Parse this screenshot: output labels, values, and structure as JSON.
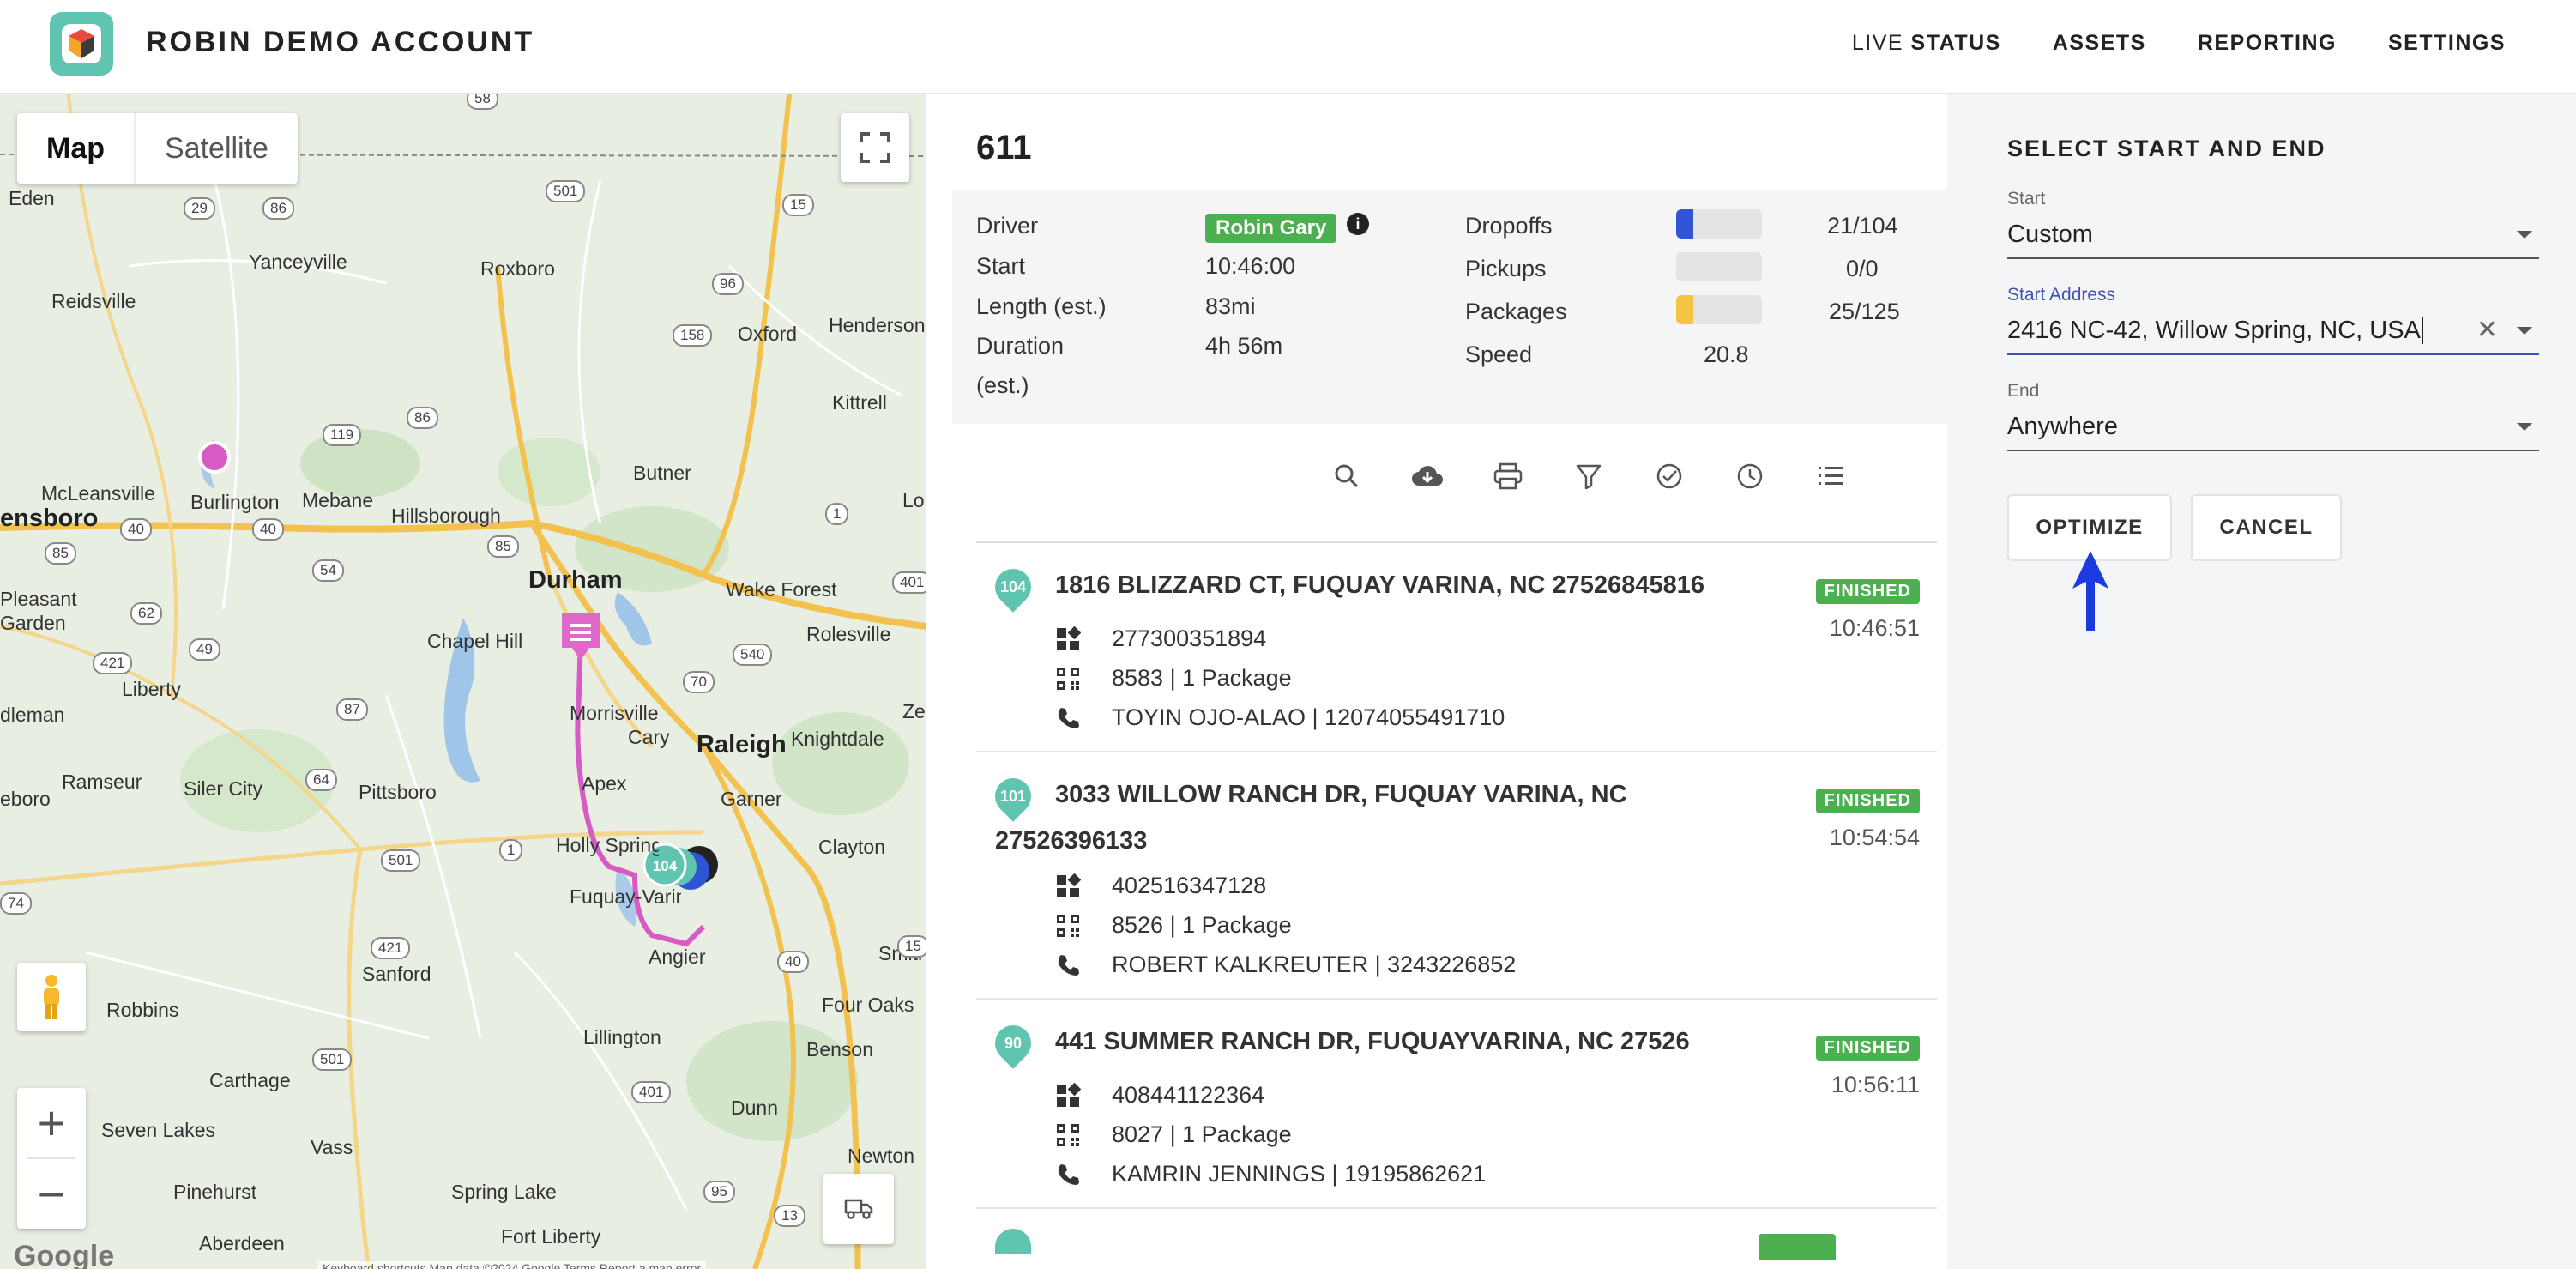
{
  "header": {
    "brand": "ROBIN DEMO ACCOUNT",
    "nav": [
      {
        "light": "LIVE ",
        "bold": "STATUS"
      },
      {
        "light": "",
        "bold": "ASSETS"
      },
      {
        "light": "",
        "bold": "REPORTING"
      },
      {
        "light": "",
        "bold": "SETTINGS"
      }
    ]
  },
  "map": {
    "toggle": {
      "map": "Map",
      "satellite": "Satellite"
    },
    "places": [
      "Eden",
      "Yanceyville",
      "Roxboro",
      "Oxford",
      "Henderson",
      "Reidsville",
      "Kittrell",
      "Butner",
      "McLeansville",
      "Burlington",
      "Mebane",
      "Hillsborough",
      "Durham",
      "Wake Forest",
      "Rolesville",
      "Chapel Hill",
      "Morrisville",
      "Cary",
      "Raleigh",
      "Knightdale",
      "Liberty",
      "Apex",
      "Garner",
      "Ramseur",
      "Siler City",
      "Pittsboro",
      "Holly Springs",
      "Clayton",
      "Fuquay-Varina",
      "Angier",
      "Four Oaks",
      "Sanford",
      "Robbins",
      "Lillington",
      "Benson",
      "Carthage",
      "Seven Lakes",
      "Vass",
      "Dunn",
      "Newton",
      "Pinehurst",
      "Spring Lake",
      "Fort Liberty",
      "Aberdeen",
      "Smith",
      "ensboro",
      "Pleasant Garden",
      "dleman",
      "eboro",
      "Lo",
      "Ze"
    ],
    "shields": [
      "58",
      "29",
      "86",
      "501",
      "15",
      "96",
      "158",
      "119",
      "86",
      "85",
      "54",
      "40",
      "40",
      "62",
      "49",
      "421",
      "87",
      "64",
      "70",
      "540",
      "1",
      "401",
      "501",
      "421",
      "40",
      "1",
      "15",
      "501",
      "401",
      "95",
      "13",
      "74",
      "85"
    ],
    "cluster_label": "104",
    "google": "Google",
    "footer": "Keyboard shortcuts   Map data ©2024 Google   Terms   Report a map error"
  },
  "route": {
    "title": "611",
    "driver_label": "Driver",
    "driver": "Robin Gary",
    "start_label": "Start",
    "start": "10:46:00",
    "length_label": "Length (est.)",
    "length": "83mi",
    "duration_label": "Duration",
    "duration_label2": "(est.)",
    "duration": "4h 56m",
    "dropoffs_label": "Dropoffs",
    "dropoffs": "21/104",
    "dropoffs_progress": 0.2,
    "pickups_label": "Pickups",
    "pickups": "0/0",
    "pickups_progress": 0,
    "packages_label": "Packages",
    "packages": "25/125",
    "packages_progress": 0.2,
    "speed_label": "Speed",
    "speed": "20.8"
  },
  "toolbar_icons": [
    "search-icon",
    "cloud-download-icon",
    "print-icon",
    "filter-icon",
    "check-circle-icon",
    "clock-icon",
    "list-icon"
  ],
  "stops": [
    {
      "num": "104",
      "address": "1816 BLIZZARD CT, FUQUAY VARINA, NC 27526845816",
      "status": "FINISHED",
      "time": "10:46:51",
      "barcode": "277300351894",
      "pkg": "8583 | 1 Package",
      "contact": "TOYIN OJO-ALAO | 12074055491710"
    },
    {
      "num": "101",
      "address": "3033 WILLOW RANCH DR, FUQUAY VARINA, NC 27526396133",
      "status": "FINISHED",
      "time": "10:54:54",
      "barcode": "402516347128",
      "pkg": "8526 | 1 Package",
      "contact": "ROBERT KALKREUTER | 3243226852"
    },
    {
      "num": "90",
      "address": "441 SUMMER RANCH DR, FUQUAYVARINA, NC 27526",
      "status": "FINISHED",
      "time": "10:56:11",
      "barcode": "408441122364",
      "pkg": "8027 | 1 Package",
      "contact": "KAMRIN JENNINGS | 19195862621"
    }
  ],
  "panel": {
    "title": "SELECT START AND END",
    "start_label": "Start",
    "start_value": "Custom",
    "address_label": "Start Address",
    "address_value": "2416 NC-42, Willow Spring, NC, USA",
    "end_label": "End",
    "end_value": "Anywhere",
    "optimize": "OPTIMIZE",
    "cancel": "CANCEL"
  },
  "colors": {
    "accent": "#5fc4b0",
    "finished": "#4caf50",
    "focus": "#3f51b5",
    "dropoff_bar": "#2f55d4",
    "package_bar": "#f4c542",
    "route": "#d65bc4"
  }
}
